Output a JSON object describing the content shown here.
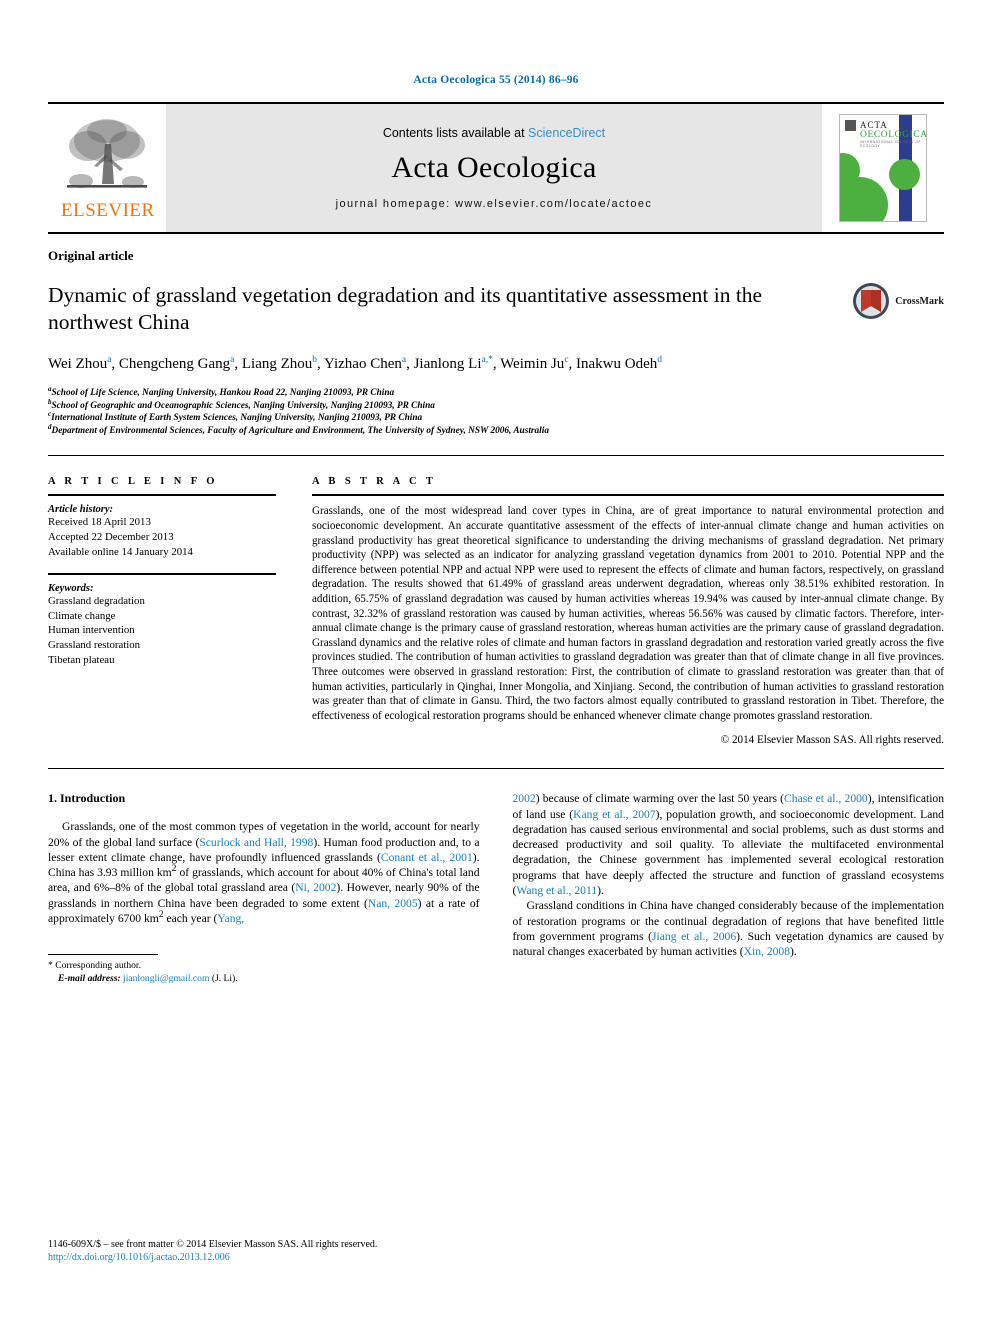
{
  "running_head": "Acta Oecologica 55 (2014) 86–96",
  "masthead": {
    "contents_prefix": "Contents lists available at ",
    "sciencedirect": "ScienceDirect",
    "journal_name": "Acta Oecologica",
    "homepage": "journal homepage: www.elsevier.com/locate/actoec",
    "publisher_wordmark": "ELSEVIER",
    "cover": {
      "line1": "ACTA",
      "line2": "OECOLOGICA",
      "line3": "INTERNATIONAL JOURNAL OF ECOLOGY"
    }
  },
  "article": {
    "kind": "Original article",
    "title": "Dynamic of grassland vegetation degradation and its quantitative assessment in the northwest China",
    "crossmark_label": "CrossMark",
    "authors": [
      {
        "name": "Wei Zhou",
        "sup": "a",
        "sep": ", "
      },
      {
        "name": "Chengcheng Gang",
        "sup": "a",
        "sep": ", "
      },
      {
        "name": "Liang Zhou",
        "sup": "b",
        "sep": ", "
      },
      {
        "name": "Yizhao Chen",
        "sup": "a",
        "sep": ", "
      },
      {
        "name": "Jianlong Li",
        "sup": "a,*",
        "sep": ", "
      },
      {
        "name": "Weimin Ju",
        "sup": "c",
        "sep": ", "
      },
      {
        "name": "Inakwu Odeh",
        "sup": "d",
        "sep": ""
      }
    ],
    "affiliations": [
      {
        "sup": "a",
        "text": "School of Life Science, Nanjing University, Hankou Road 22, Nanjing 210093, PR China"
      },
      {
        "sup": "b",
        "text": "School of Geographic and Oceanographic Sciences, Nanjing University, Nanjing 210093, PR China"
      },
      {
        "sup": "c",
        "text": "International Institute of Earth System Sciences, Nanjing University, Nanjing 210093, PR China"
      },
      {
        "sup": "d",
        "text": "Department of Environmental Sciences, Faculty of Agriculture and Environment, The University of Sydney, NSW 2006, Australia"
      }
    ]
  },
  "article_info": {
    "heading": "A R T I C L E  I N F O",
    "history_label": "Article history:",
    "history": [
      "Received 18 April 2013",
      "Accepted 22 December 2013",
      "Available online 14 January 2014"
    ],
    "keywords_label": "Keywords:",
    "keywords": [
      "Grassland degradation",
      "Climate change",
      "Human intervention",
      "Grassland restoration",
      "Tibetan plateau"
    ]
  },
  "abstract": {
    "heading": "A B S T R A C T",
    "text": "Grasslands, one of the most widespread land cover types in China, are of great importance to natural environmental protection and socioeconomic development. An accurate quantitative assessment of the effects of inter-annual climate change and human activities on grassland productivity has great theoretical significance to understanding the driving mechanisms of grassland degradation. Net primary productivity (NPP) was selected as an indicator for analyzing grassland vegetation dynamics from 2001 to 2010. Potential NPP and the difference between potential NPP and actual NPP were used to represent the effects of climate and human factors, respectively, on grassland degradation. The results showed that 61.49% of grassland areas underwent degradation, whereas only 38.51% exhibited restoration. In addition, 65.75% of grassland degradation was caused by human activities whereas 19.94% was caused by inter-annual climate change. By contrast, 32.32% of grassland restoration was caused by human activities, whereas 56.56% was caused by climatic factors. Therefore, inter-annual climate change is the primary cause of grassland restoration, whereas human activities are the primary cause of grassland degradation. Grassland dynamics and the relative roles of climate and human factors in grassland degradation and restoration varied greatly across the five provinces studied. The contribution of human activities to grassland degradation was greater than that of climate change in all five provinces. Three outcomes were observed in grassland restoration: First, the contribution of climate to grassland restoration was greater than that of human activities, particularly in Qinghai, Inner Mongolia, and Xinjiang. Second, the contribution of human activities to grassland restoration was greater than that of climate in Gansu. Third, the two factors almost equally contributed to grassland restoration in Tibet. Therefore, the effectiveness of ecological restoration programs should be enhanced whenever climate change promotes grassland restoration.",
    "copyright": "© 2014 Elsevier Masson SAS. All rights reserved."
  },
  "intro": {
    "heading": "1. Introduction",
    "left_p1_a": "Grasslands, one of the most common types of vegetation in the world, account for nearly 20% of the global land surface (",
    "left_cit1": "Scurlock and Hall, 1998",
    "left_p1_b": "). Human food production and, to a lesser extent climate change, have profoundly influenced grasslands (",
    "left_cit2": "Conant et al., 2001",
    "left_p1_c": "). China has 3.93 million km",
    "left_p1_d": " of grasslands, which account for about 40% of China's total land area, and 6%–8% of the global total grassland area (",
    "left_cit3": "Ni, 2002",
    "left_p1_e": "). However, nearly 90% of the grasslands in northern China have been degraded to some extent (",
    "left_cit4": "Nan, 2005",
    "left_p1_f": ") at a rate of approximately 6700 km",
    "left_p1_g": " each year (",
    "left_cit5": "Yang,",
    "right_p1_a": "2002",
    "right_p1_b": ") because of climate warming over the last 50 years (",
    "right_cit1": "Chase et al., 2000",
    "right_p1_c": "), intensification of land use (",
    "right_cit2": "Kang et al., 2007",
    "right_p1_d": "), population growth, and socioeconomic development. Land degradation has caused serious environmental and social problems, such as dust storms and decreased productivity and soil quality. To alleviate the multifaceted environmental degradation, the Chinese government has implemented several ecological restoration programs that have deeply affected the structure and function of grassland ecosystems (",
    "right_cit3": "Wang et al., 2011",
    "right_p1_e": ").",
    "right_p2_a": "Grassland conditions in China have changed considerably because of the implementation of restoration programs or the continual degradation of regions that have benefited little from government programs (",
    "right_cit4": "Jiang et al., 2006",
    "right_p2_b": "). Such vegetation dynamics are caused by natural changes exacerbated by human activities (",
    "right_cit5": "Xin, 2008",
    "right_p2_c": ")."
  },
  "footnotes": {
    "corresponding": "* Corresponding author.",
    "email_label": "E-mail address:",
    "email": "jianlongli@gmail.com",
    "email_owner": "(J. Li)."
  },
  "page_footer": {
    "issn_line": "1146-609X/$ – see front matter © 2014 Elsevier Masson SAS. All rights reserved.",
    "doi": "http://dx.doi.org/10.1016/j.actao.2013.12.006"
  }
}
